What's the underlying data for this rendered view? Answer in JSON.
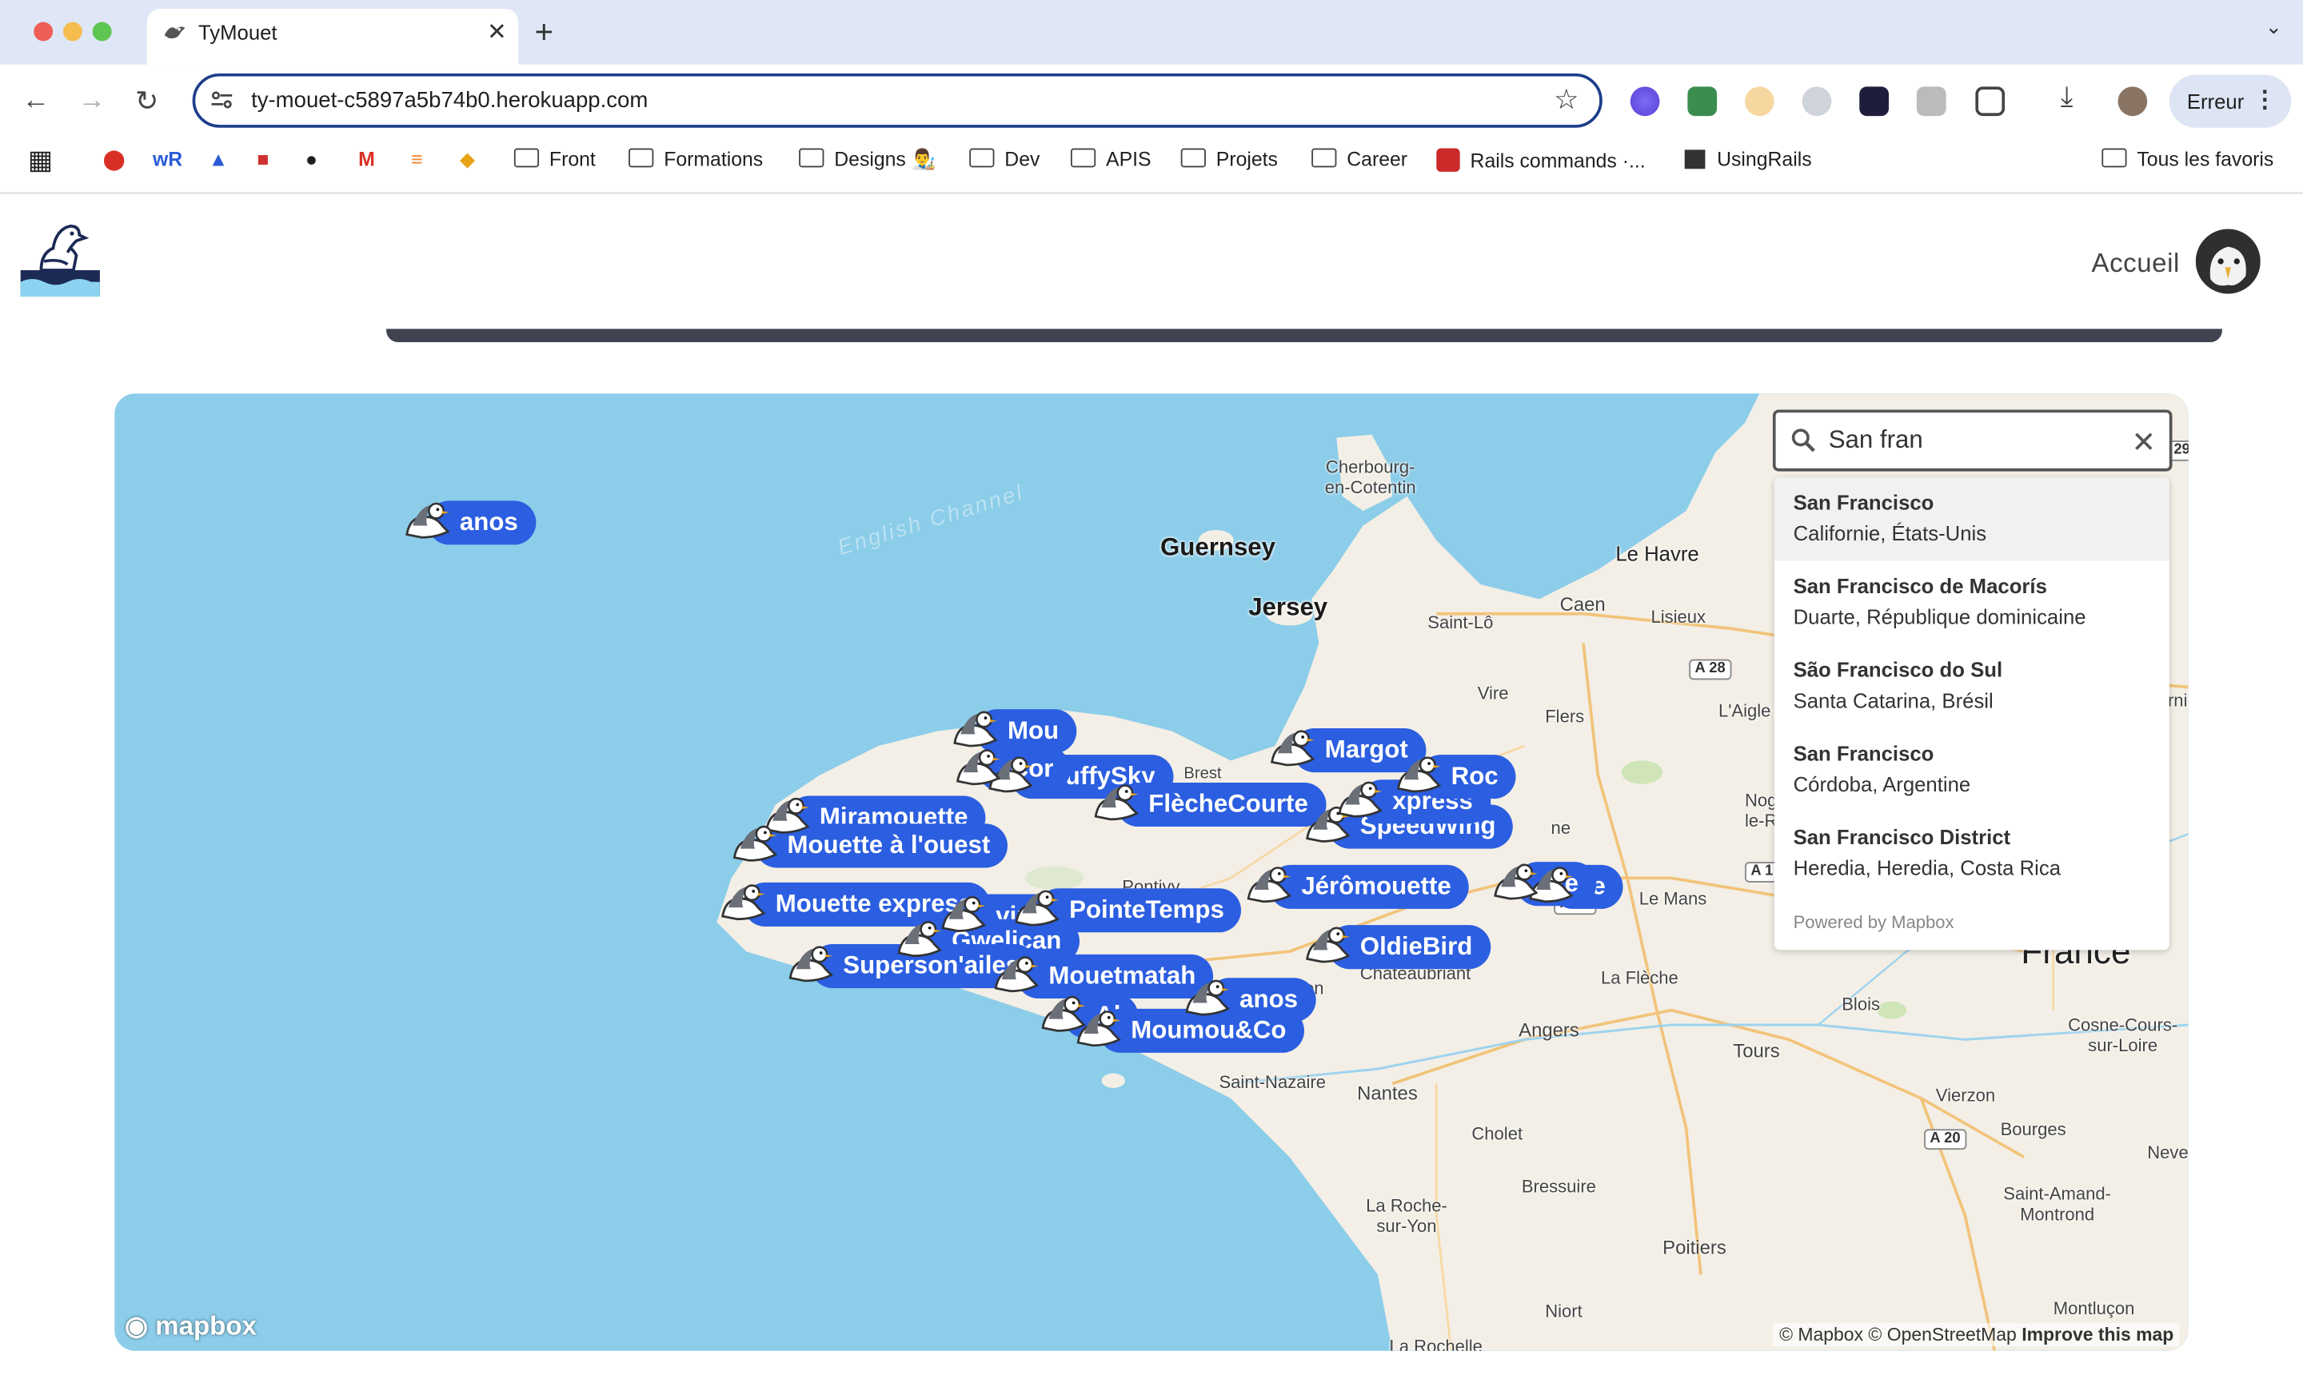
{
  "browser": {
    "tab_title": "TyMouet",
    "url": "ty-mouet-c5897a5b74b0.herokuapp.com",
    "profile_label": "Erreur",
    "bookmarks": [
      "Front",
      "Formations",
      "Designs 👨‍🎨",
      "Dev",
      "APIS",
      "Projets",
      "Career",
      "Rails commands ·...",
      "UsingRails",
      "Tous les favoris"
    ]
  },
  "header": {
    "nav_home": "Accueil"
  },
  "search": {
    "value": "San fran",
    "results": [
      {
        "name": "San Francisco",
        "region": "Californie, États-Unis"
      },
      {
        "name": "San Francisco de Macorís",
        "region": "Duarte, République dominicaine"
      },
      {
        "name": "São Francisco do Sul",
        "region": "Santa Catarina, Brésil"
      },
      {
        "name": "San Francisco",
        "region": "Córdoba, Argentine"
      },
      {
        "name": "San Francisco District",
        "region": "Heredia, Heredia, Costa Rica"
      }
    ],
    "powered_by": "Powered by Mapbox"
  },
  "map": {
    "sea_label": "English Channel",
    "places": {
      "guernsey": "Guernsey",
      "jersey": "Jersey",
      "cherbourg": "Cherbourg-\nen-Cotentin",
      "le_havre": "Le Havre",
      "caen": "Caen",
      "lisieux": "Lisieux",
      "saint_lo": "Saint-Lô",
      "vire": "Vire",
      "flers": "Flers",
      "laigle": "L'Aigle",
      "nogent": "Nog\nle-R",
      "le_mans": "Le Mans",
      "la_fleche": "La Flèche",
      "pontivy": "Pontivy",
      "chateaubriant": "Chateaubriant",
      "angers": "Angers",
      "saint_nazaire": "Saint-Nazaire",
      "nantes": "Nantes",
      "cholet": "Cholet",
      "tours": "Tours",
      "blois": "Blois",
      "vierzon": "Vierzon",
      "bourges": "Bourges",
      "bressuire": "Bressuire",
      "la_roche": "La Roche-\nsur-Yon",
      "poitiers": "Poitiers",
      "niort": "Niort",
      "la_rochelle": "La Rochelle",
      "cosne": "Cosne-Cours-\nsur-Loire",
      "saint_amand": "Saint-Amand-\nMontrond",
      "montlucon": "Montluçon",
      "nevers": "Never",
      "france": "France",
      "rnie": "rnie",
      "brest": "Brest",
      "on": "on",
      "ne": "ne"
    },
    "roads": [
      "A 28",
      "A 81",
      "A 20",
      "A 1",
      "29"
    ],
    "markers": [
      "PointeTemps",
      "Margot",
      "Mou",
      "FluffySky",
      "Cor",
      "FlècheCourte",
      "Miramouette",
      "Mouette à l'ouest",
      "SpeedWing",
      "Jérômouette",
      "te",
      "tte",
      "Mouette express",
      "ving",
      "Gwelican",
      "OldieBird",
      "Superson'ailes",
      "Mouetmatah",
      "Al",
      "anos",
      "Moumou&Co",
      "xpress",
      "Roc"
    ],
    "attribution": "© Mapbox © OpenStreetMap",
    "improve": "Improve this map",
    "logo_text": "mapbox"
  }
}
